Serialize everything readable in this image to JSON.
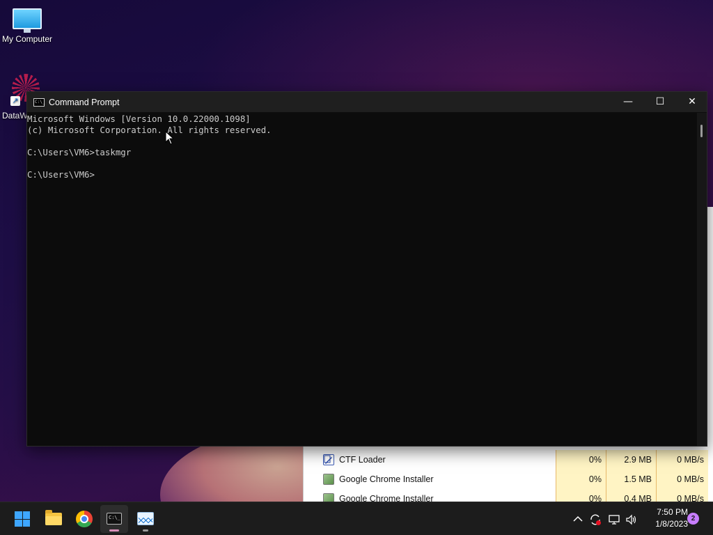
{
  "desktop": {
    "icons": [
      {
        "label": "My Computer",
        "icon": "monitor-icon"
      },
      {
        "label": "DataW",
        "icon": "datawrapper-shortcut-icon"
      }
    ]
  },
  "taskmgr_rows": [
    {
      "name": "CTF Loader",
      "cpu": "0%",
      "memory": "2.9 MB",
      "disk": "0 MB/s",
      "icon": "ctf-loader-icon"
    },
    {
      "name": "Google Chrome Installer",
      "cpu": "0%",
      "memory": "1.5 MB",
      "disk": "0 MB/s",
      "icon": "installer-icon"
    },
    {
      "name": "Google Chrome Installer",
      "cpu": "0%",
      "memory": "0.4 MB",
      "disk": "0 MB/s",
      "icon": "installer-icon"
    }
  ],
  "cmd": {
    "title": "Command Prompt",
    "minimize": "—",
    "maximize": "☐",
    "close": "✕",
    "lines": [
      "Microsoft Windows [Version 10.0.22000.1098]",
      "(c) Microsoft Corporation. All rights reserved.",
      "",
      "C:\\Users\\VM6>taskmgr",
      "",
      "C:\\Users\\VM6>"
    ]
  },
  "taskbar": {
    "apps": [
      "start-button",
      "file-explorer",
      "google-chrome",
      "command-prompt",
      "task-manager"
    ],
    "tray": {
      "chevron": "^",
      "time": "7:50 PM",
      "date": "1/8/2023",
      "notifications": "2"
    }
  },
  "colors": {
    "console_bg": "#0c0c0c",
    "console_text": "#cccccc",
    "titlebar_bg": "#1f1f1f",
    "taskbar_bg": "#1c1c1c",
    "accent": "#3ea6ff",
    "taskmgr_highlight": "#fff4c4"
  }
}
